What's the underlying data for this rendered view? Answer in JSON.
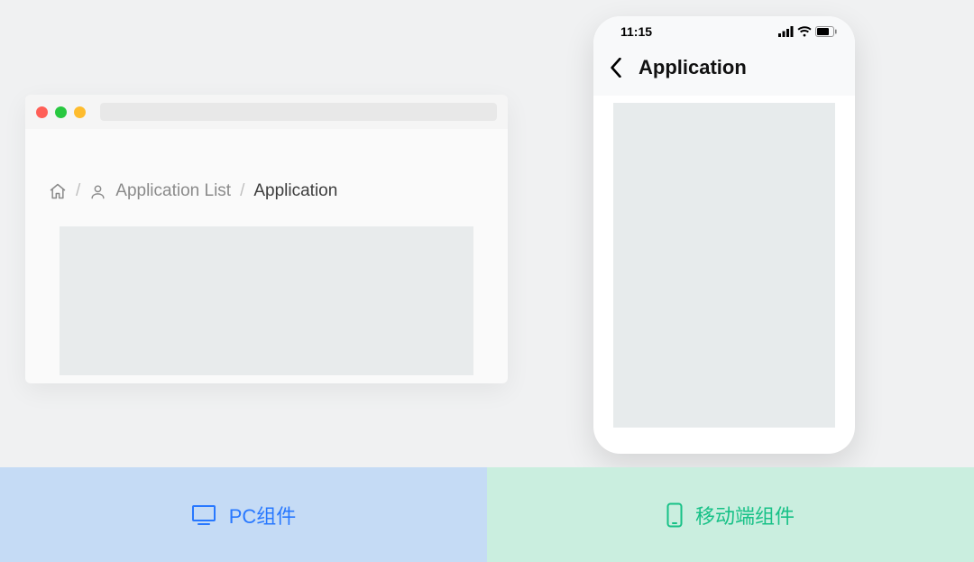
{
  "pc": {
    "breadcrumb": {
      "list_label": "Application List",
      "current_label": "Application"
    }
  },
  "mobile": {
    "status_time": "11:15",
    "header_title": "Application"
  },
  "footer": {
    "pc_label": "PC组件",
    "mobile_label": "移动端组件"
  }
}
